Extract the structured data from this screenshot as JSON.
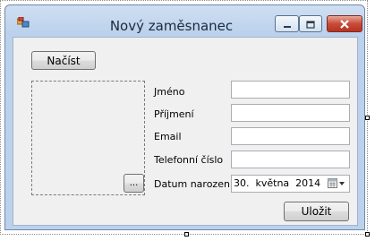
{
  "window": {
    "title": "Nový zaměsnanec",
    "icons": {
      "app": "form-app-icon",
      "minimize": "minimize-icon",
      "maximize": "maximize-icon",
      "close": "close-icon"
    }
  },
  "form": {
    "load_button": "Načíst",
    "browse_button": "...",
    "save_button": "Uložit",
    "fields": {
      "first_name": {
        "label": "Jméno",
        "value": ""
      },
      "last_name": {
        "label": "Příjmení",
        "value": ""
      },
      "email": {
        "label": "Email",
        "value": ""
      },
      "phone": {
        "label": "Telefonní číslo",
        "value": ""
      },
      "birth_date": {
        "label": "Datum narození",
        "value": "30.  května  2014"
      }
    },
    "date_picker_icon": "calendar-dropdown-icon"
  }
}
